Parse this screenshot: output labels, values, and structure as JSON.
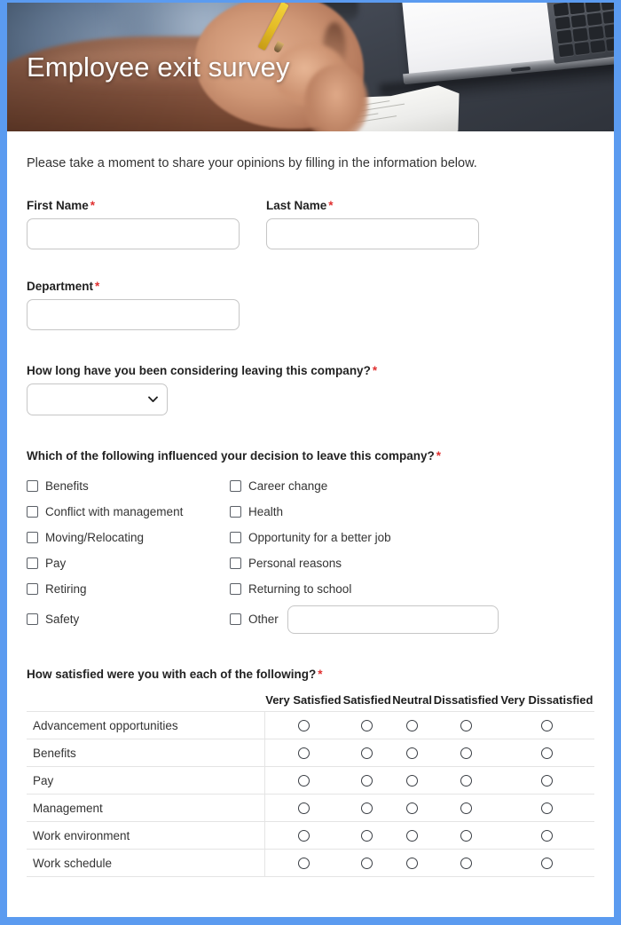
{
  "theme": {
    "accent": "#5b9bf0",
    "required_color": "#e03030",
    "title_color": "#ffffff"
  },
  "header": {
    "title": "Employee exit survey",
    "image_alt": "hand writing with pencil on paper beside a laptop"
  },
  "intro": "Please take a moment to share your opinions by filling in the information below.",
  "required_marker": "*",
  "fields": {
    "first_name": {
      "label": "First Name",
      "value": "",
      "placeholder": ""
    },
    "last_name": {
      "label": "Last Name",
      "value": "",
      "placeholder": ""
    },
    "department": {
      "label": "Department",
      "value": "",
      "placeholder": ""
    }
  },
  "duration": {
    "label": "How long have you been considering leaving this company?",
    "selected": "",
    "options": [
      ""
    ]
  },
  "influences": {
    "label": "Which of the following influenced your decision to leave this company?",
    "left": [
      "Benefits",
      "Conflict with management",
      "Moving/Relocating",
      "Pay",
      "Retiring",
      "Safety"
    ],
    "right": [
      "Career change",
      "Health",
      "Opportunity for a better job",
      "Personal reasons",
      "Returning to school",
      "Other"
    ],
    "other_value": "",
    "other_placeholder": ""
  },
  "satisfaction": {
    "label": "How satisfied were you with each of the following?",
    "columns": [
      "Very Satisfied",
      "Satisfied",
      "Neutral",
      "Dissatisfied",
      "Very Dissatisfied"
    ],
    "rows": [
      "Advancement opportunities",
      "Benefits",
      "Pay",
      "Management",
      "Work environment",
      "Work schedule"
    ]
  }
}
